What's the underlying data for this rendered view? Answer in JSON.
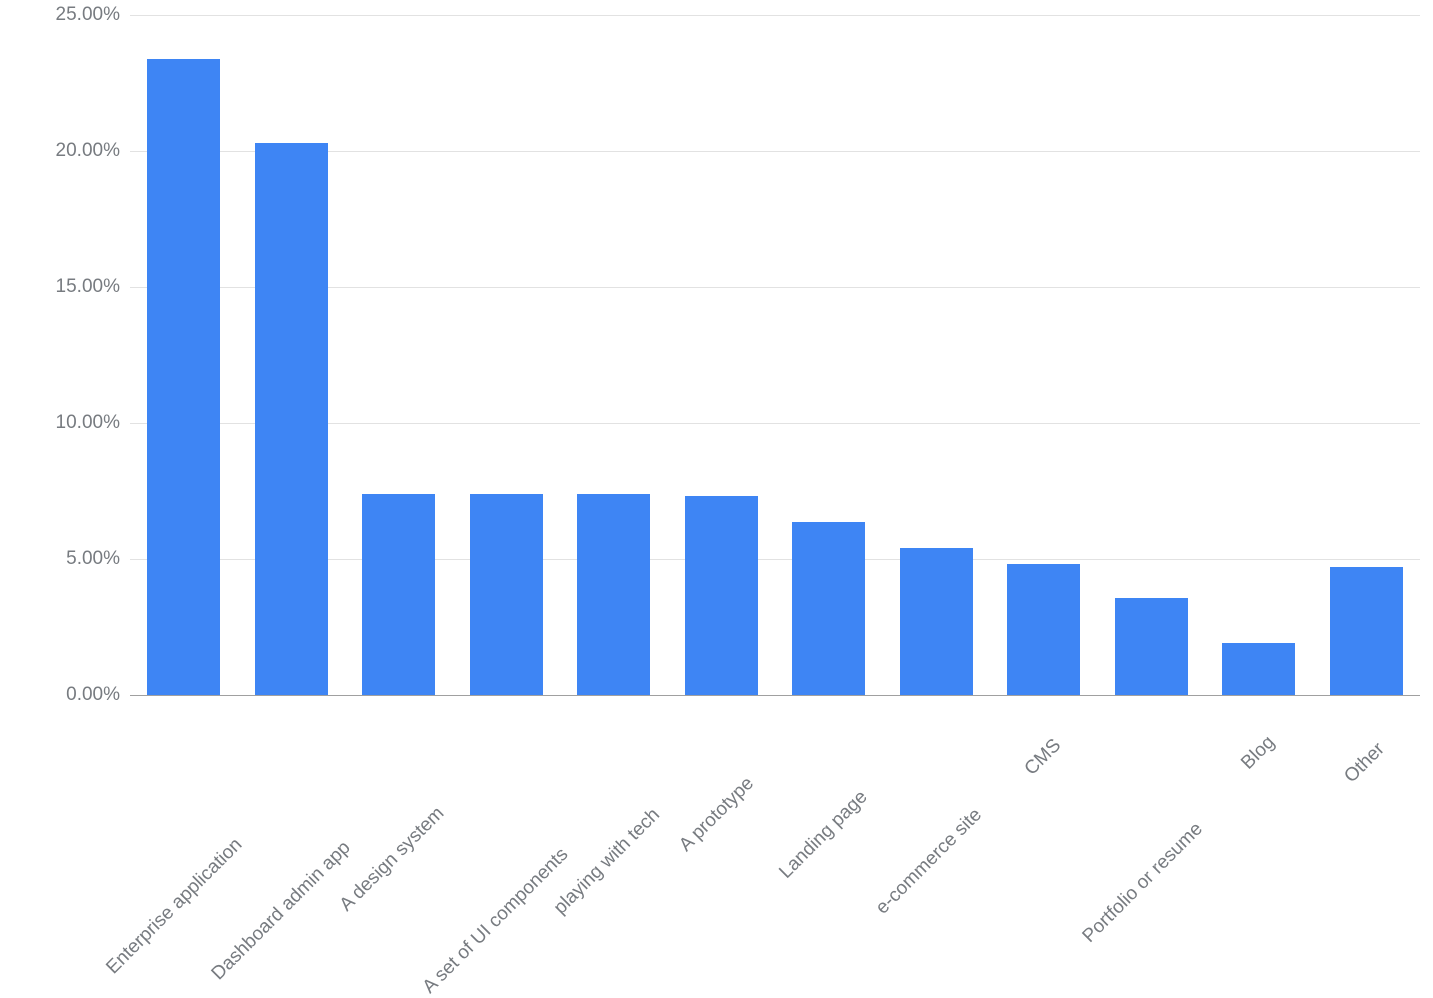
{
  "chart_data": {
    "type": "bar",
    "categories": [
      "Enterprise application",
      "Dashboard admin app",
      "A design system",
      "A set of UI components",
      "playing with tech",
      "A prototype",
      "Landing page",
      "e-commerce site",
      "CMS",
      "Portfolio or resume",
      "Blog",
      "Other"
    ],
    "values": [
      23.4,
      20.3,
      7.4,
      7.4,
      7.4,
      7.3,
      6.35,
      5.4,
      4.8,
      3.55,
      1.9,
      4.7
    ],
    "title": "",
    "xlabel": "",
    "ylabel": "",
    "ylim": [
      0,
      25
    ],
    "ytick_step": 5,
    "ytick_format": "percent_2dp",
    "bar_color": "#3e85f4",
    "grid": true
  },
  "yticks": {
    "0": "0.00%",
    "1": "5.00%",
    "2": "10.00%",
    "3": "15.00%",
    "4": "20.00%",
    "5": "25.00%"
  },
  "xticks": {
    "0": "Enterprise application",
    "1": "Dashboard admin app",
    "2": "A design system",
    "3": "A set of UI components",
    "4": "playing with tech",
    "5": "A prototype",
    "6": "Landing page",
    "7": "e-commerce site",
    "8": "CMS",
    "9": "Portfolio or resume",
    "10": "Blog",
    "11": "Other"
  }
}
